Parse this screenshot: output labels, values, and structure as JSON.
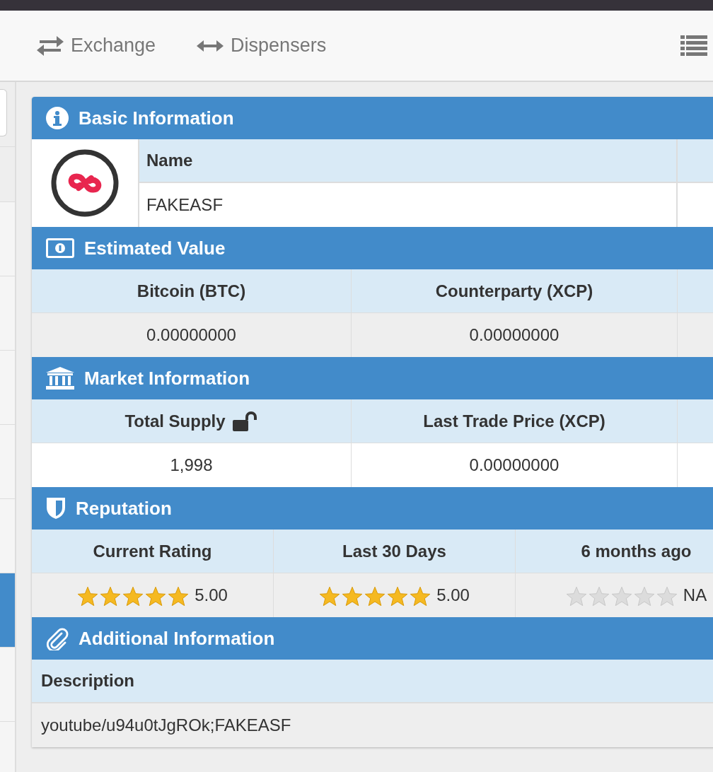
{
  "nav": [
    {
      "label": "Exchange",
      "kind": "exchange"
    },
    {
      "label": "Dispensers",
      "kind": "dispensers"
    }
  ],
  "sidebar": {
    "items": [
      {
        "selected": false
      },
      {
        "selected": false
      },
      {
        "selected": false
      },
      {
        "selected": false
      },
      {
        "selected": false
      },
      {
        "selected": true
      },
      {
        "selected": false
      },
      {
        "selected": false
      }
    ]
  },
  "basic_information": {
    "title": "Basic Information",
    "name_label": "Name",
    "name": "FAKEASF"
  },
  "estimated_value": {
    "title": "Estimated Value",
    "columns": [
      "Bitcoin (BTC)",
      "Counterparty (XCP)"
    ],
    "values": [
      "0.00000000",
      "0.00000000"
    ]
  },
  "market_information": {
    "title": "Market Information",
    "columns": [
      "Total Supply",
      "Last Trade Price (XCP)"
    ],
    "supply_locked": false,
    "values": [
      "1,998",
      "0.00000000"
    ]
  },
  "reputation": {
    "title": "Reputation",
    "ratings": [
      {
        "label": "Current Rating",
        "stars": 5,
        "score": "5.00"
      },
      {
        "label": "Last 30 Days",
        "stars": 5,
        "score": "5.00"
      },
      {
        "label": "6 months ago",
        "stars": 0,
        "score": "NA"
      }
    ]
  },
  "additional_information": {
    "title": "Additional Information",
    "description_label": "Description",
    "description": "youtube/u94u0tJgROk;FAKEASF"
  }
}
